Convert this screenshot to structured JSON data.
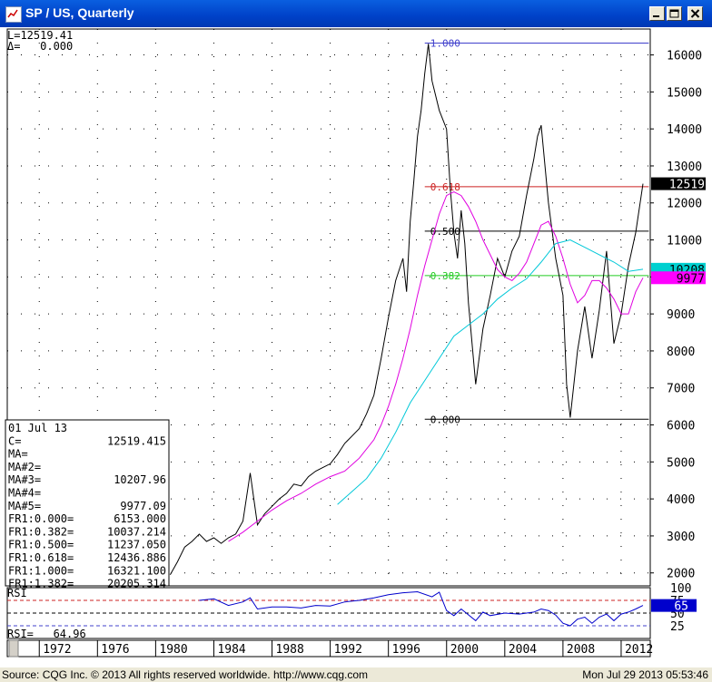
{
  "window": {
    "title": "SP / US, Quarterly"
  },
  "header": {
    "last_line": "L=12519.41",
    "delta_line": "Δ=   0.000"
  },
  "info_panel": [
    [
      "01 Jul 13",
      ""
    ],
    [
      "C=",
      "12519.415"
    ],
    [
      "MA=",
      ""
    ],
    [
      "MA#2=",
      ""
    ],
    [
      "MA#3=",
      "10207.96"
    ],
    [
      "MA#4=",
      ""
    ],
    [
      "MA#5=",
      "9977.09"
    ],
    [
      "FR1:0.000=",
      "6153.000"
    ],
    [
      "FR1:0.382=",
      "10037.214"
    ],
    [
      "FR1:0.500=",
      "11237.050"
    ],
    [
      "FR1:0.618=",
      "12436.886"
    ],
    [
      "FR1:1.000=",
      "16321.100"
    ],
    [
      "FR1:1.382=",
      "20205.314"
    ]
  ],
  "rsi": {
    "label": "RSI",
    "value_line": "RSI=   64.96",
    "ticks": [
      "100",
      "75",
      "50",
      "25"
    ],
    "current": "65"
  },
  "price_tags": {
    "last": "12519",
    "ma3": "10208",
    "ma5": "9977"
  },
  "colors": {
    "price": "#000000",
    "ma3": "#00c8d8",
    "ma5": "#e000e0",
    "fib_red": "#cc2222",
    "fib_green": "#22cc22",
    "fib_blue": "#4040cc",
    "rsi": "#0000cc",
    "tag_last": "#000000",
    "tag_ma3": "#00d0d0",
    "tag_ma5": "#ff00ff"
  },
  "statusbar": {
    "source": "Source: CQG Inc. © 2013 All rights reserved worldwide. http://www.cqg.com",
    "timestamp": "Mon Jul 29 2013 05:53:46"
  },
  "chart_data": {
    "type": "line",
    "title": "SP / US, Quarterly",
    "xlim": [
      1969.8,
      2014.0
    ],
    "ylim": [
      1650,
      16700
    ],
    "x_ticks": [
      "1972",
      "1976",
      "1980",
      "1984",
      "1988",
      "1992",
      "1996",
      "2000",
      "2004",
      "2008",
      "2012"
    ],
    "y_ticks": [
      2000,
      3000,
      4000,
      5000,
      6000,
      7000,
      8000,
      9000,
      10000,
      11000,
      12000,
      13000,
      14000,
      15000,
      16000
    ],
    "grid": true,
    "series": [
      {
        "id": "price",
        "x": [
          1981.0,
          1981.5,
          1982.0,
          1982.5,
          1983.0,
          1983.5,
          1984.0,
          1984.5,
          1985.0,
          1985.5,
          1986.0,
          1986.5,
          1987.0,
          1987.5,
          1988.0,
          1988.5,
          1989.0,
          1989.5,
          1990.0,
          1990.5,
          1991.0,
          1991.5,
          1992.0,
          1992.5,
          1993.0,
          1993.5,
          1994.0,
          1994.5,
          1995.0,
          1995.5,
          1996.0,
          1996.5,
          1997.0,
          1997.25,
          1997.5,
          1997.75,
          1998.0,
          1998.25,
          1998.5,
          1998.75,
          1999.0,
          1999.5,
          2000.0,
          2000.25,
          2000.5,
          2000.75,
          2001.0,
          2001.25,
          2001.5,
          2002.0,
          2002.5,
          2003.0,
          2003.5,
          2004.0,
          2004.5,
          2005.0,
          2005.5,
          2006.0,
          2006.25,
          2006.5,
          2007.0,
          2007.5,
          2008.0,
          2008.25,
          2008.5,
          2009.0,
          2009.5,
          2010.0,
          2010.5,
          2011.0,
          2011.5,
          2012.0,
          2012.5,
          2013.0,
          2013.5
        ],
        "y": [
          1950,
          2300,
          2700,
          2850,
          3050,
          2850,
          2950,
          2800,
          2950,
          3050,
          3400,
          4700,
          3300,
          3600,
          3800,
          4000,
          4150,
          4400,
          4350,
          4600,
          4750,
          4850,
          4950,
          5200,
          5500,
          5700,
          5900,
          6300,
          6800,
          7800,
          8900,
          9900,
          10500,
          9600,
          11500,
          12600,
          13800,
          14500,
          15500,
          16300,
          15300,
          14500,
          14000,
          12400,
          11200,
          10500,
          11800,
          10900,
          9300,
          7100,
          8600,
          9500,
          10500,
          10000,
          10700,
          11100,
          12200,
          13200,
          13800,
          14100,
          12000,
          10500,
          9500,
          7100,
          6200,
          8000,
          9200,
          7800,
          9100,
          10700,
          8200,
          9000,
          10300,
          11200,
          12519
        ]
      },
      {
        "id": "ma5",
        "x": [
          1985.0,
          1986.0,
          1987.0,
          1988.0,
          1989.0,
          1990.0,
          1991.0,
          1992.0,
          1993.0,
          1994.0,
          1995.0,
          1995.5,
          1996.0,
          1996.5,
          1997.0,
          1997.5,
          1998.0,
          1998.5,
          1999.0,
          1999.5,
          2000.0,
          2000.5,
          2001.0,
          2001.5,
          2002.0,
          2002.5,
          2003.0,
          2003.5,
          2004.0,
          2004.5,
          2005.0,
          2005.5,
          2006.0,
          2006.5,
          2007.0,
          2007.5,
          2008.0,
          2008.5,
          2009.0,
          2009.5,
          2010.0,
          2010.5,
          2011.0,
          2011.5,
          2012.0,
          2012.5,
          2013.0,
          2013.5
        ],
        "y": [
          2850,
          3100,
          3400,
          3700,
          3950,
          4150,
          4400,
          4600,
          4750,
          5100,
          5600,
          6000,
          6500,
          7100,
          7800,
          8600,
          9500,
          10300,
          11000,
          11700,
          12200,
          12300,
          12200,
          11900,
          11500,
          11000,
          10600,
          10200,
          10000,
          9900,
          10100,
          10400,
          10900,
          11400,
          11500,
          11100,
          10500,
          9800,
          9300,
          9500,
          9900,
          9900,
          9700,
          9400,
          9000,
          9000,
          9600,
          9977
        ]
      },
      {
        "id": "ma3",
        "x": [
          1992.5,
          1993.5,
          1994.5,
          1995.5,
          1996.5,
          1997.5,
          1998.5,
          1999.5,
          2000.5,
          2001.5,
          2002.5,
          2003.5,
          2004.5,
          2005.5,
          2006.5,
          2007.5,
          2008.5,
          2009.5,
          2010.5,
          2011.5,
          2012.5,
          2013.5
        ],
        "y": [
          3850,
          4200,
          4550,
          5100,
          5800,
          6600,
          7200,
          7800,
          8400,
          8700,
          9000,
          9400,
          9700,
          9950,
          10400,
          10900,
          11000,
          10800,
          10600,
          10400,
          10150,
          10208
        ]
      }
    ],
    "fib_levels": [
      {
        "label": "1.000",
        "value": 16321.1
      },
      {
        "label": "0.618",
        "value": 12436.886
      },
      {
        "label": "0.500",
        "value": 11237.05
      },
      {
        "label": "0.382",
        "value": 10037.214
      },
      {
        "label": "0.000",
        "value": 6153.0
      }
    ],
    "rsi": {
      "ylim": [
        0,
        100
      ],
      "ref_lines": [
        75,
        50,
        25
      ],
      "x": [
        1983.0,
        1984.0,
        1985.0,
        1986.0,
        1986.5,
        1987.0,
        1988.0,
        1989.0,
        1990.0,
        1991.0,
        1992.0,
        1993.0,
        1994.0,
        1995.0,
        1996.0,
        1997.0,
        1998.0,
        1999.0,
        1999.5,
        2000.0,
        2000.5,
        2001.0,
        2002.0,
        2002.5,
        2003.0,
        2004.0,
        2005.0,
        2006.0,
        2006.5,
        2007.0,
        2007.5,
        2008.0,
        2008.5,
        2009.0,
        2009.5,
        2010.0,
        2010.5,
        2011.0,
        2011.5,
        2012.0,
        2012.5,
        2013.0,
        2013.5
      ],
      "values": [
        75,
        78,
        65,
        72,
        80,
        58,
        62,
        62,
        60,
        65,
        64,
        72,
        75,
        80,
        86,
        90,
        92,
        82,
        91,
        55,
        45,
        58,
        35,
        52,
        45,
        50,
        48,
        52,
        58,
        55,
        46,
        30,
        25,
        38,
        42,
        30,
        42,
        48,
        35,
        48,
        52,
        58,
        64.96
      ]
    }
  }
}
